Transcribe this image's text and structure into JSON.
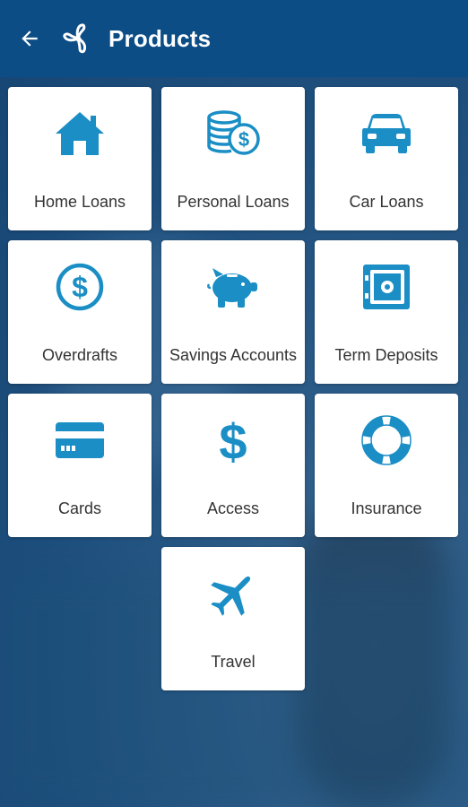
{
  "header": {
    "title": "Products",
    "back_icon": "arrow-left-icon",
    "logo_icon": "propeller-logo-icon",
    "background": "#0d4d86"
  },
  "colors": {
    "icon_blue": "#1a8ec5",
    "tile_bg": "#ffffff",
    "label_text": "#333333"
  },
  "products": [
    {
      "label": "Home Loans",
      "icon": "house-icon"
    },
    {
      "label": "Personal Loans",
      "icon": "coin-stack-icon"
    },
    {
      "label": "Car Loans",
      "icon": "car-icon"
    },
    {
      "label": "Overdrafts",
      "icon": "dollar-circle-icon"
    },
    {
      "label": "Savings Accounts",
      "icon": "piggy-bank-icon"
    },
    {
      "label": "Term Deposits",
      "icon": "safe-icon"
    },
    {
      "label": "Cards",
      "icon": "credit-card-icon"
    },
    {
      "label": "Access",
      "icon": "dollar-sign-icon"
    },
    {
      "label": "Insurance",
      "icon": "life-ring-icon"
    },
    {
      "label": "Travel",
      "icon": "airplane-icon"
    }
  ]
}
